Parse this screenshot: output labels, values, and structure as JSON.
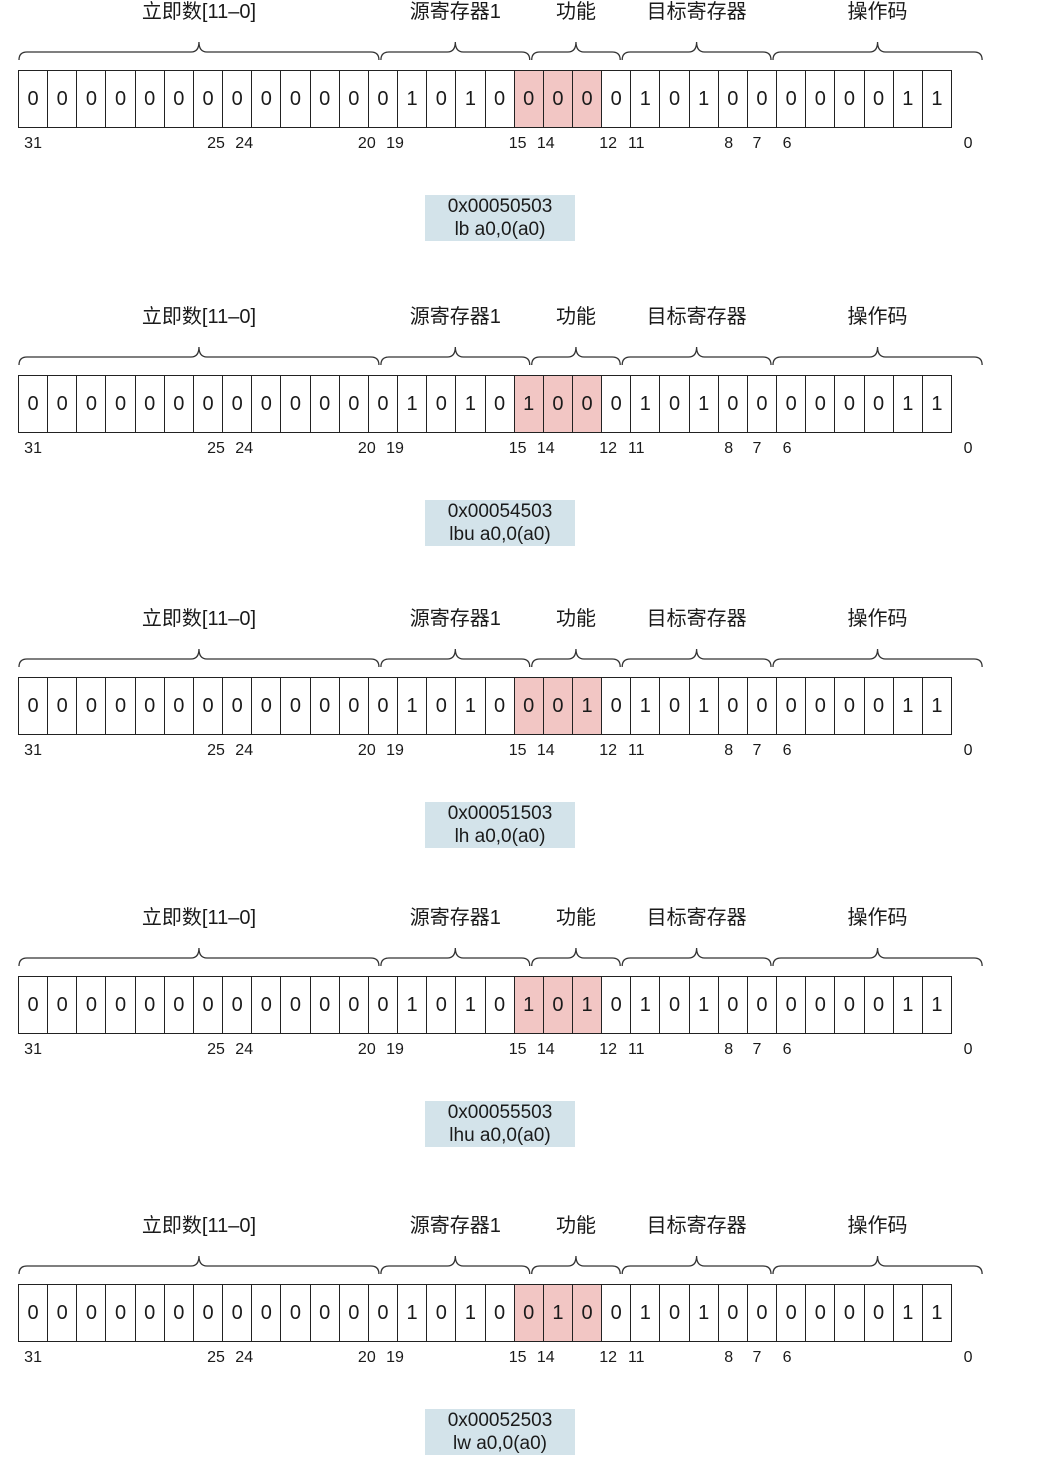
{
  "field_labels": {
    "imm": "立即数[11–0]",
    "rs1": "源寄存器1",
    "funct3": "功能",
    "rd": "目标寄存器",
    "opcode": "操作码"
  },
  "bit_positions": [
    "31",
    "25",
    "24",
    "20",
    "19",
    "15",
    "14",
    "12",
    "11",
    "8",
    "7",
    "6",
    "0"
  ],
  "instructions": [
    {
      "hex": "0x00050503",
      "asm": "lb a0,0(a0)",
      "bits": [
        "0",
        "0",
        "0",
        "0",
        "0",
        "0",
        "0",
        "0",
        "0",
        "0",
        "0",
        "0",
        "0",
        "1",
        "0",
        "1",
        "0",
        "0",
        "0",
        "0",
        "0",
        "1",
        "0",
        "1",
        "0",
        "0",
        "0",
        "0",
        "0",
        "0",
        "1",
        "1"
      ]
    },
    {
      "hex": "0x00054503",
      "asm": "lbu a0,0(a0)",
      "bits": [
        "0",
        "0",
        "0",
        "0",
        "0",
        "0",
        "0",
        "0",
        "0",
        "0",
        "0",
        "0",
        "0",
        "1",
        "0",
        "1",
        "0",
        "1",
        "0",
        "0",
        "0",
        "1",
        "0",
        "1",
        "0",
        "0",
        "0",
        "0",
        "0",
        "0",
        "1",
        "1"
      ]
    },
    {
      "hex": "0x00051503",
      "asm": "lh a0,0(a0)",
      "bits": [
        "0",
        "0",
        "0",
        "0",
        "0",
        "0",
        "0",
        "0",
        "0",
        "0",
        "0",
        "0",
        "0",
        "1",
        "0",
        "1",
        "0",
        "0",
        "0",
        "1",
        "0",
        "1",
        "0",
        "1",
        "0",
        "0",
        "0",
        "0",
        "0",
        "0",
        "1",
        "1"
      ]
    },
    {
      "hex": "0x00055503",
      "asm": "lhu a0,0(a0)",
      "bits": [
        "0",
        "0",
        "0",
        "0",
        "0",
        "0",
        "0",
        "0",
        "0",
        "0",
        "0",
        "0",
        "0",
        "1",
        "0",
        "1",
        "0",
        "1",
        "0",
        "1",
        "0",
        "1",
        "0",
        "1",
        "0",
        "0",
        "0",
        "0",
        "0",
        "0",
        "1",
        "1"
      ]
    },
    {
      "hex": "0x00052503",
      "asm": "lw a0,0(a0)",
      "bits": [
        "0",
        "0",
        "0",
        "0",
        "0",
        "0",
        "0",
        "0",
        "0",
        "0",
        "0",
        "0",
        "0",
        "1",
        "0",
        "1",
        "0",
        "0",
        "1",
        "0",
        "0",
        "1",
        "0",
        "1",
        "0",
        "0",
        "0",
        "0",
        "0",
        "0",
        "1",
        "1"
      ]
    }
  ],
  "highlight_color": "#f2c6c4",
  "caption_color": "#d3e3ea"
}
